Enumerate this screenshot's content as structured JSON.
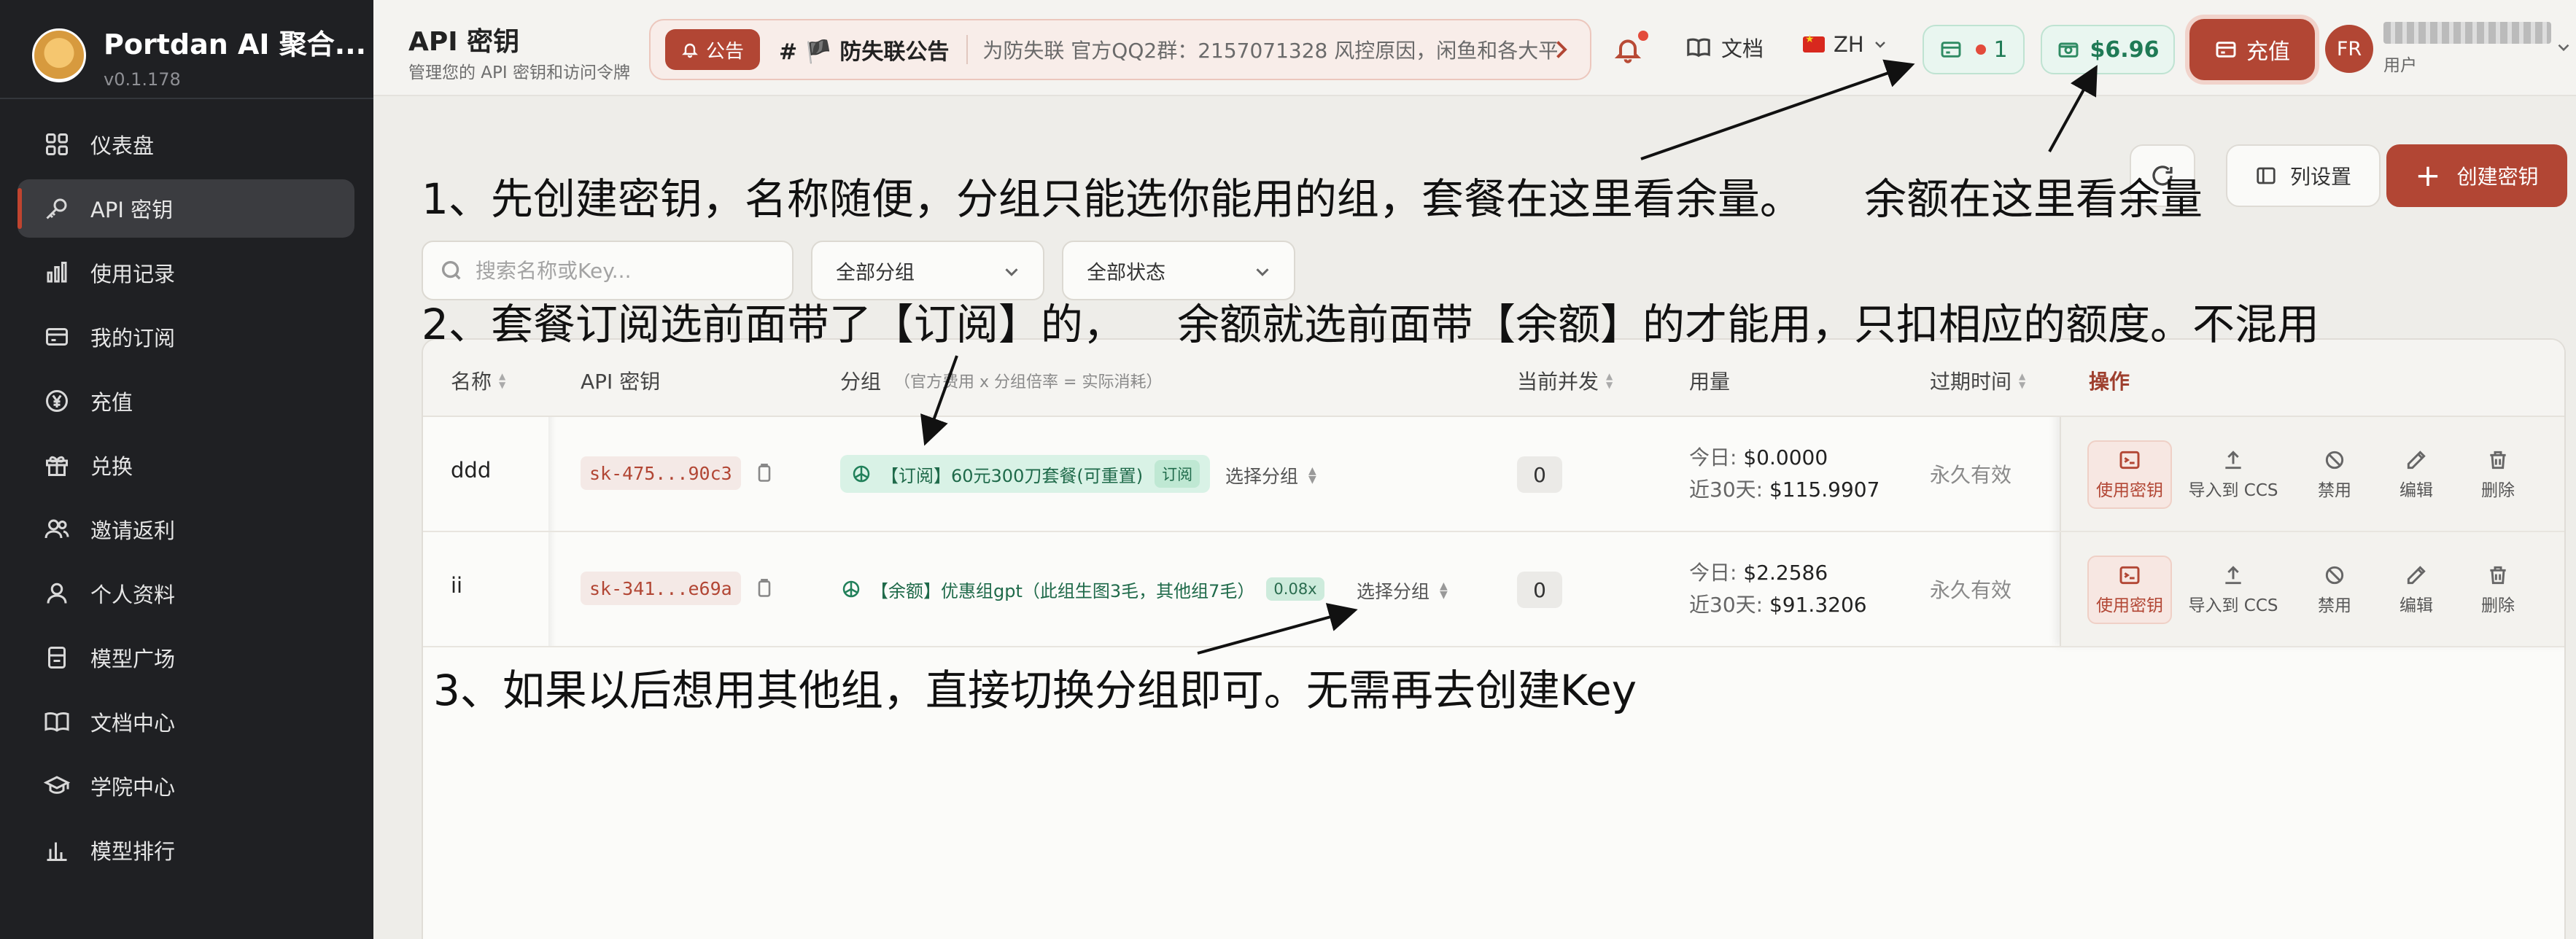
{
  "sidebar": {
    "brand_name": "Portdan AI 聚合...",
    "version": "v0.1.178",
    "items": [
      {
        "label": "仪表盘",
        "icon": "dashboard-icon"
      },
      {
        "label": "API 密钥",
        "icon": "key-icon",
        "active": true
      },
      {
        "label": "使用记录",
        "icon": "bar-chart-icon"
      },
      {
        "label": "我的订阅",
        "icon": "card-icon"
      },
      {
        "label": "充值",
        "icon": "yen-icon"
      },
      {
        "label": "兑换",
        "icon": "gift-icon"
      },
      {
        "label": "邀请返利",
        "icon": "users-icon"
      },
      {
        "label": "个人资料",
        "icon": "user-icon"
      },
      {
        "label": "模型广场",
        "icon": "store-icon"
      },
      {
        "label": "文档中心",
        "icon": "book-icon"
      },
      {
        "label": "学院中心",
        "icon": "graduation-icon"
      },
      {
        "label": "模型排行",
        "icon": "ranking-icon"
      }
    ]
  },
  "header": {
    "title": "API 密钥",
    "subtitle": "管理您的 API 密钥和访问令牌",
    "notice_badge": "公告",
    "notice_title": "# 🏴 防失联公告",
    "notice_text": "为防失联 官方QQ2群：2157071328 风控原因，闲鱼和各大平...",
    "docs_label": "文档",
    "lang_label": "ZH",
    "subscription_count": "1",
    "balance": "$6.96",
    "recharge_label": "充值",
    "user_initials": "FR",
    "user_role": "用户"
  },
  "toolbar": {
    "columns_label": "列设置",
    "create_label": "创建密钥",
    "search_placeholder": "搜索名称或Key...",
    "group_filter": "全部分组",
    "status_filter": "全部状态"
  },
  "table": {
    "columns": {
      "name": "名称",
      "key": "API 密钥",
      "group": "分组",
      "group_hint": "（官方费用 x 分组倍率 = 实际消耗）",
      "concurrency": "当前并发",
      "usage": "用量",
      "expiry": "过期时间",
      "actions": "操作"
    },
    "action_labels": {
      "use": "使用密钥",
      "import": "导入到 CCS",
      "disable": "禁用",
      "edit": "编辑",
      "delete": "删除"
    },
    "select_group_label": "选择分组",
    "rows": [
      {
        "name": "ddd",
        "key": "sk-475...90c3",
        "group": "【订阅】60元300刀套餐(可重置)",
        "group_tag": "订阅",
        "concurrency": "0",
        "today_label": "今日:",
        "today": "$0.0000",
        "month_label": "近30天:",
        "month": "$115.9907",
        "expiry": "永久有效"
      },
      {
        "name": "ii",
        "key": "sk-341...e69a",
        "group": "【余额】优惠组gpt（此组生图3毛，其他组7毛）",
        "group_tag": "0.08x",
        "concurrency": "0",
        "today_label": "今日:",
        "today": "$2.2586",
        "month_label": "近30天:",
        "month": "$91.3206",
        "expiry": "永久有效"
      }
    ]
  },
  "annotations": {
    "a1": "1、先创建密钥，名称随便，分组只能选你能用的组，套餐在这里看余量。",
    "a1b": "余额在这里看余量",
    "a2": "2、套餐订阅选前面带了【订阅】的，",
    "a2b": "余额就选前面带【余额】的才能用，只扣相应的额度。不混用",
    "a3": "3、如果以后想用其他组，直接切换分组即可。无需再去创建Key"
  },
  "colors": {
    "sidebar_bg": "#1f2023",
    "accent": "#b24634",
    "success": "#1f7a55",
    "page_bg": "#eeede9"
  }
}
